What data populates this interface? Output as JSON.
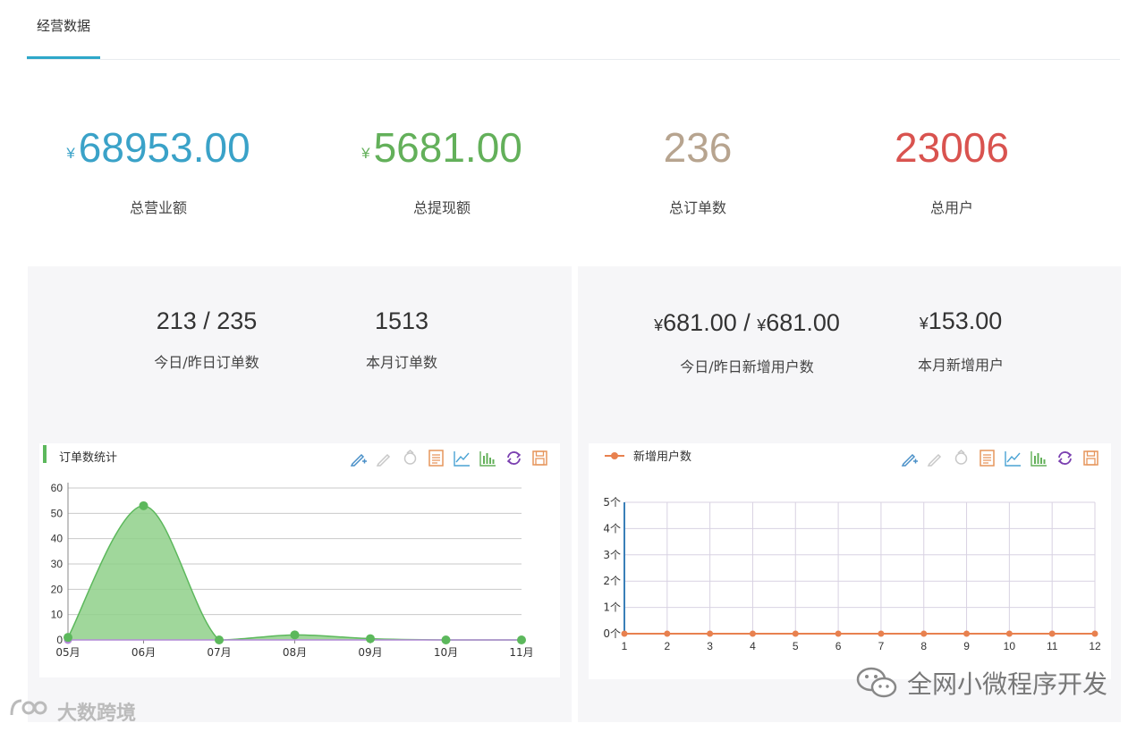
{
  "tabs": {
    "active_label": "经营数据"
  },
  "summary": [
    {
      "currency": "¥",
      "value": "68953.00",
      "label": "总营业额",
      "color": "#3aa2c8"
    },
    {
      "currency": "¥",
      "value": "5681.00",
      "label": "总提现额",
      "color": "#63b05a"
    },
    {
      "currency": "",
      "value": "236",
      "label": "总订单数",
      "color": "#b7a48f"
    },
    {
      "currency": "",
      "value": "23006",
      "label": "总用户",
      "color": "#d9534f"
    }
  ],
  "orders_panel": {
    "today_yesterday": {
      "value": "213 / 235",
      "label": "今日/昨日订单数"
    },
    "month": {
      "value": "1513",
      "label": "本月订单数"
    }
  },
  "users_panel": {
    "today_yesterday": {
      "cur1": "¥",
      "val1": "681.00",
      "sep": " / ",
      "cur2": "¥",
      "val2": "681.00",
      "label": "今日/昨日新增用户数"
    },
    "month": {
      "cur": "¥",
      "val": "153.00",
      "label": "本月新增用户"
    }
  },
  "toolbox_icons": [
    "zoom-icon",
    "zoom-reset-icon",
    "restore-icon",
    "data-view-icon",
    "line-chart-icon",
    "bar-chart-icon",
    "refresh-icon",
    "save-image-icon"
  ],
  "chart_data": [
    {
      "type": "area",
      "title": "订单数统计",
      "categories": [
        "05月",
        "06月",
        "07月",
        "08月",
        "09月",
        "10月",
        "11月"
      ],
      "yticks": [
        "0",
        "10",
        "20",
        "30",
        "40",
        "50",
        "60"
      ],
      "ylim": [
        0,
        60
      ],
      "series": [
        {
          "values": [
            1,
            53,
            0,
            2,
            0.5,
            0,
            0
          ],
          "color": "#5cb85c"
        },
        {
          "values": [
            0,
            0,
            0,
            0,
            0,
            0,
            0
          ],
          "color": "#b48ad8"
        }
      ]
    },
    {
      "type": "line",
      "categories": [
        "1",
        "2",
        "3",
        "4",
        "5",
        "6",
        "7",
        "8",
        "9",
        "10",
        "11",
        "12"
      ],
      "yticks": [
        "0个",
        "1个",
        "2个",
        "3个",
        "4个",
        "5个"
      ],
      "ylim": [
        0,
        5
      ],
      "series": [
        {
          "name": "新增用户数",
          "values": [
            0,
            0,
            0,
            0,
            0,
            0,
            0,
            0,
            0,
            0,
            0,
            0
          ],
          "color": "#e8814f"
        }
      ]
    }
  ],
  "watermark": {
    "text": "全网小微程序开发"
  },
  "brand": {
    "text": "大数跨境"
  }
}
